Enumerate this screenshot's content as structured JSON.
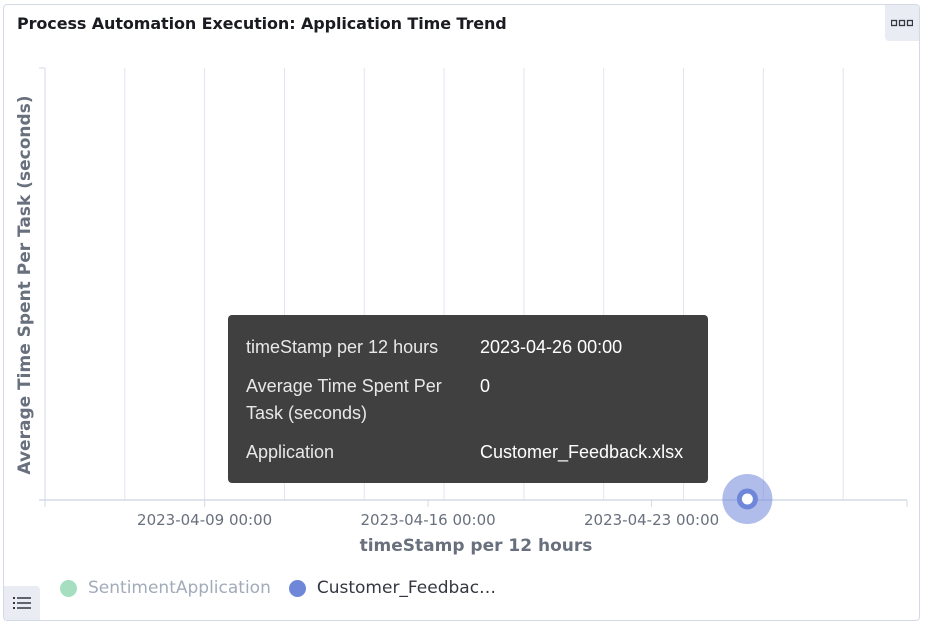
{
  "panel": {
    "title": "Process Automation Execution: Application Time Trend",
    "options_icon": "more-horizontal-icon",
    "legend_toggle_icon": "list-icon"
  },
  "chart_data": {
    "type": "scatter",
    "xlabel": "timeStamp per 12 hours",
    "ylabel": "Average Time Spent Per Task (seconds)",
    "x_ticks": [
      "2023-04-09 00:00",
      "2023-04-16 00:00",
      "2023-04-23 00:00"
    ],
    "x_range": [
      "2023-04-04 00:00",
      "2023-05-01 00:00"
    ],
    "series": [
      {
        "name": "SentimentApplication",
        "color": "#a5dfc0",
        "points": []
      },
      {
        "name": "Customer_Feedback.xlsx",
        "color": "#6f87d8",
        "points": [
          {
            "x": "2023-04-26 00:00",
            "y": 0
          }
        ]
      }
    ],
    "grid": true,
    "legend_placement": "bottom-left"
  },
  "legend": {
    "items": [
      {
        "label": "SentimentApplication",
        "color": "#a5dfc0",
        "dimmed": true
      },
      {
        "label": "Customer_Feedbac…",
        "color": "#6f87d8",
        "dimmed": false
      }
    ]
  },
  "tooltip": {
    "rows": [
      {
        "key": "timeStamp per 12 hours",
        "value": "2023-04-26 00:00"
      },
      {
        "key": "Average Time Spent Per Task (seconds)",
        "value": "0"
      },
      {
        "key": "Application",
        "value": "Customer_Feedback.xlsx"
      }
    ]
  }
}
